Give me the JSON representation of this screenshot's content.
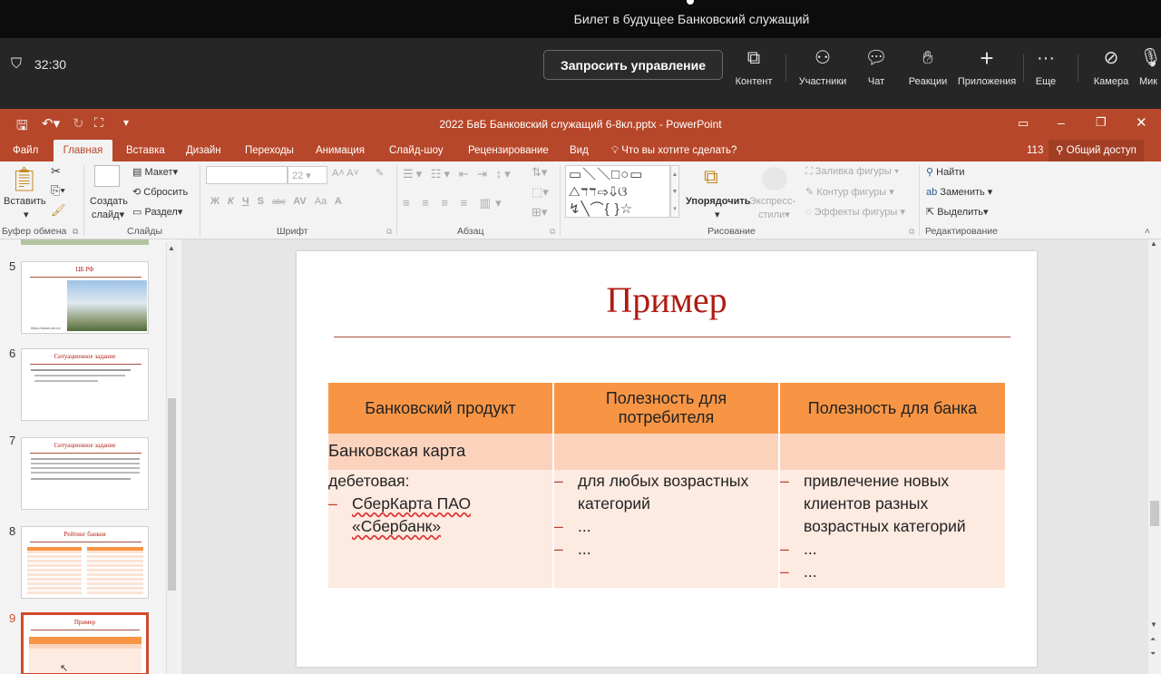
{
  "meeting": {
    "title": "Билет в будущее Банковский служащий",
    "timer": "32:30",
    "request_control": "Запросить управление",
    "toolbar": [
      {
        "name": "content",
        "label": "Контент",
        "icon": "share-screen-icon"
      },
      {
        "name": "participants",
        "label": "Участники",
        "icon": "people-icon"
      },
      {
        "name": "chat",
        "label": "Чат",
        "icon": "chat-icon"
      },
      {
        "name": "reactions",
        "label": "Реакции",
        "icon": "hand-icon"
      },
      {
        "name": "apps",
        "label": "Приложения",
        "icon": "plus-icon"
      },
      {
        "name": "more",
        "label": "Еще",
        "icon": "more-icon"
      },
      {
        "name": "camera",
        "label": "Камера",
        "icon": "camera-off-icon"
      },
      {
        "name": "mic",
        "label": "Мик",
        "icon": "mic-icon"
      }
    ]
  },
  "ppt": {
    "window_title": "2022 БвБ Банковский служащий 6-8кл.pptx - PowerPoint",
    "tabs": [
      "Файл",
      "Главная",
      "Вставка",
      "Дизайн",
      "Переходы",
      "Анимация",
      "Слайд-шоу",
      "Рецензирование",
      "Вид"
    ],
    "active_tab": "Главная",
    "tell_me": "Что вы хотите сделать?",
    "comments_count": "113",
    "share": "Общий доступ",
    "ribbon": {
      "paste": "Вставить",
      "clipboard_group": "Буфер обмена",
      "new_slide_1": "Создать",
      "new_slide_2": "слайд",
      "layout": "Макет",
      "reset": "Сбросить",
      "section": "Раздел",
      "slides_group": "Слайды",
      "font_size": "22",
      "font_group": "Шрифт",
      "paragraph_group": "Абзац",
      "arrange": "Упорядочить",
      "quick_styles_1": "Экспресс-",
      "quick_styles_2": "стили",
      "shape_fill": "Заливка фигуры",
      "shape_outline": "Контур фигуры",
      "shape_effects": "Эффекты фигуры",
      "drawing_group": "Рисование",
      "find": "Найти",
      "replace": "Заменить",
      "select": "Выделить",
      "editing_group": "Редактирование",
      "format_buttons": [
        "Ж",
        "К",
        "Ч",
        "S",
        "abc",
        "AV",
        "Aa",
        "A"
      ]
    },
    "thumbnails": [
      {
        "num": "5",
        "title": "ЦБ РФ",
        "caption": "https://www.cbr.ru/"
      },
      {
        "num": "6",
        "title": "Ситуационное задание"
      },
      {
        "num": "7",
        "title": "Ситуационное задание"
      },
      {
        "num": "8",
        "title": "Рейтинг банков"
      },
      {
        "num": "9",
        "title": "Пример"
      }
    ],
    "slide": {
      "title": "Пример",
      "headers": [
        "Банковский продукт",
        "Полезность для потребителя",
        "Полезность для банка"
      ],
      "row1": {
        "c1": "Банковская карта"
      },
      "row2": {
        "c1_intro": "дебетовая:",
        "c1_items": [
          "СберКарта ПАО «Сбербанк»"
        ],
        "c2_items": [
          "для любых возрастных категорий",
          "...",
          "..."
        ],
        "c3_items": [
          "привлечение новых клиентов разных возрастных категорий",
          "...",
          "..."
        ]
      }
    }
  }
}
